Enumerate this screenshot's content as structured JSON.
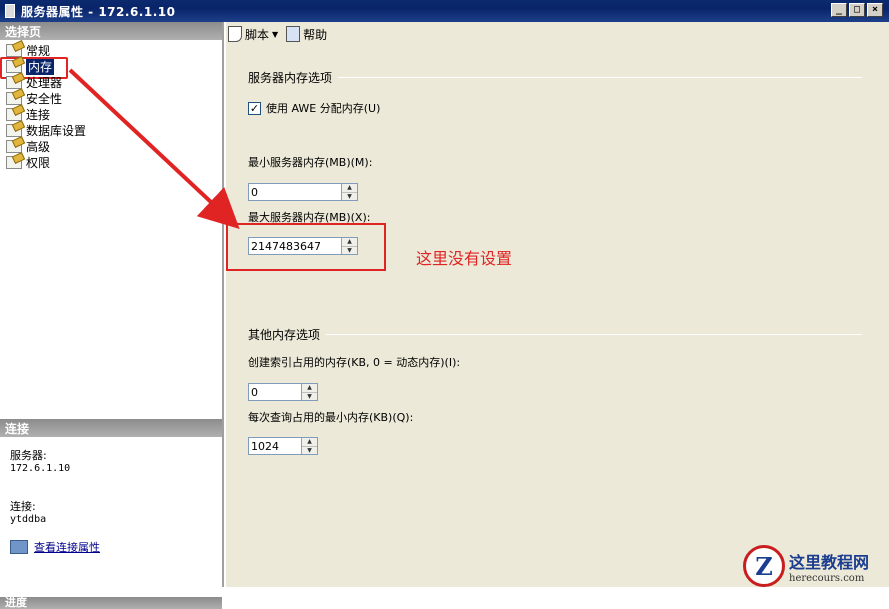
{
  "window": {
    "title": "服务器属性 - 172.6.1.10",
    "controls": [
      "_",
      "□",
      "×"
    ]
  },
  "left": {
    "select_page_header": "选择页",
    "pages": [
      {
        "label": "常规",
        "selected": false
      },
      {
        "label": "内存",
        "selected": true
      },
      {
        "label": "处理器",
        "selected": false
      },
      {
        "label": "安全性",
        "selected": false
      },
      {
        "label": "连接",
        "selected": false
      },
      {
        "label": "数据库设置",
        "selected": false
      },
      {
        "label": "高级",
        "selected": false
      },
      {
        "label": "权限",
        "selected": false
      }
    ],
    "connection_header": "连接",
    "server_label": "服务器:",
    "server_value": "172.6.1.10",
    "connection_label": "连接:",
    "connection_value": "ytddba",
    "view_connection_link": "查看连接属性",
    "progress_header": "进度"
  },
  "toolbar": {
    "script_label": "脚本",
    "help_label": "帮助"
  },
  "server_memory": {
    "group_title": "服务器内存选项",
    "use_awe_label": "使用 AWE 分配内存(U)",
    "use_awe_checked": true,
    "min_label": "最小服务器内存(MB)(M):",
    "min_value": "0",
    "max_label": "最大服务器内存(MB)(X):",
    "max_value": "2147483647"
  },
  "annotation": {
    "text": "这里没有设置",
    "color": "#e02424"
  },
  "other_memory": {
    "group_title": "其他内存选项",
    "index_label": "创建索引占用的内存(KB, 0 = 动态内存)(I):",
    "index_value": "0",
    "query_label": "每次查询占用的最小内存(KB)(Q):",
    "query_value": "1024"
  },
  "watermark": {
    "logo_letter": "Z",
    "title": "这里教程网",
    "url": "herecours.com"
  }
}
